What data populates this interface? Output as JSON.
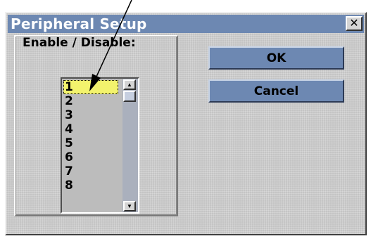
{
  "window": {
    "title": "Peripheral Setup",
    "close_glyph": "✕",
    "title_bar_color": "#6d88b2"
  },
  "group": {
    "label": "Enable / Disable:"
  },
  "list": {
    "items": [
      "1",
      "2",
      "3",
      "4",
      "5",
      "6",
      "7",
      "8"
    ],
    "selected": "1",
    "selected_color": "#f3f36d"
  },
  "scrollbar": {
    "up_glyph": "▲",
    "down_glyph": "▼"
  },
  "buttons": {
    "ok_label": "OK",
    "cancel_label": "Cancel"
  },
  "annotation": {
    "icon": "pointer-arrow-icon"
  }
}
